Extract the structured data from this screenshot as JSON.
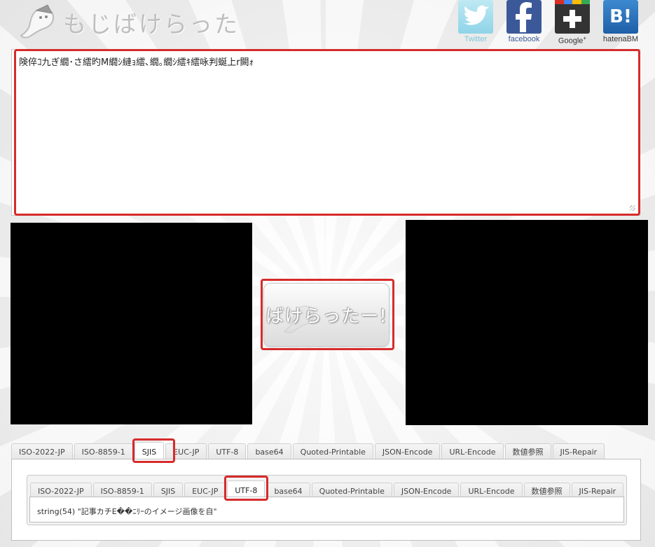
{
  "logo": {
    "text": "もじばけらった",
    "icon": "ghost-icon"
  },
  "social": [
    {
      "label": "Twitter",
      "icon": "twitter-bird-icon"
    },
    {
      "label": "facebook",
      "icon": "facebook-f-icon"
    },
    {
      "label": "Google",
      "sup": "+",
      "icon": "google-plus-icon"
    },
    {
      "label": "hatenaBM",
      "glyph": "B!",
      "icon": "hatena-bookmark-icon"
    }
  ],
  "input": {
    "value": "険倅ｺ九ぎ繝･さ繧旳M繝ｼ縺ｮ繧､繝｡繝ｼ繧ｷ繧咏判蜒上r闕ｫ"
  },
  "bake_button": {
    "label": "ばけらったー!"
  },
  "outer_tabs": [
    {
      "label": "ISO-2022-JP"
    },
    {
      "label": "ISO-8859-1"
    },
    {
      "label": "SJIS",
      "active": true
    },
    {
      "label": "EUC-JP"
    },
    {
      "label": "UTF-8"
    },
    {
      "label": "base64"
    },
    {
      "label": "Quoted-Printable"
    },
    {
      "label": "JSON-Encode"
    },
    {
      "label": "URL-Encode"
    },
    {
      "label": "数値参照"
    },
    {
      "label": "JIS-Repair"
    }
  ],
  "inner_tabs": [
    {
      "label": "ISO-2022-JP"
    },
    {
      "label": "ISO-8859-1"
    },
    {
      "label": "SJIS"
    },
    {
      "label": "EUC-JP"
    },
    {
      "label": "UTF-8",
      "active": true
    },
    {
      "label": "base64"
    },
    {
      "label": "Quoted-Printable"
    },
    {
      "label": "JSON-Encode"
    },
    {
      "label": "URL-Encode"
    },
    {
      "label": "数値参照"
    },
    {
      "label": "JIS-Repair"
    }
  ],
  "result": {
    "text": "string(54) \"記事カチE��ﾆﾘｰのイメージ画像を自\""
  },
  "colors": {
    "highlight": "#d62b2b",
    "facebook": "#3b5998",
    "hatena": "#2a6fba",
    "twitter": "#8fd4e8"
  }
}
